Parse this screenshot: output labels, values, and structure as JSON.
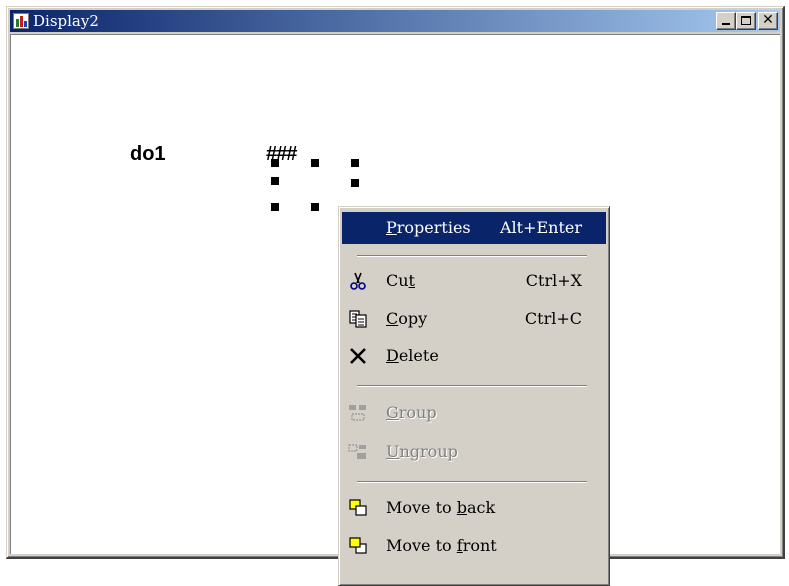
{
  "window": {
    "title": "Display2"
  },
  "canvas": {
    "label": "do1",
    "object_text": "###"
  },
  "context_menu": {
    "items": [
      {
        "pre": "",
        "key": "P",
        "post": "roperties",
        "shortcut": "Alt+Enter",
        "icon": null,
        "state": "selected"
      },
      {
        "pre": "Cu",
        "key": "t",
        "post": "",
        "shortcut": "Ctrl+X",
        "icon": "scissors-icon",
        "state": "enabled"
      },
      {
        "pre": "",
        "key": "C",
        "post": "opy",
        "shortcut": "Ctrl+C",
        "icon": "copy-icon",
        "state": "enabled"
      },
      {
        "pre": "",
        "key": "D",
        "post": "elete",
        "shortcut": "",
        "icon": "delete-x-icon",
        "state": "enabled"
      },
      {
        "pre": "",
        "key": "G",
        "post": "roup",
        "shortcut": "",
        "icon": "group-icon",
        "state": "disabled"
      },
      {
        "pre": "",
        "key": "U",
        "post": "ngroup",
        "shortcut": "",
        "icon": "ungroup-icon",
        "state": "disabled"
      },
      {
        "pre": "Move to ",
        "key": "b",
        "post": "ack",
        "shortcut": "",
        "icon": "move-to-back-icon",
        "state": "enabled"
      },
      {
        "pre": "Move to ",
        "key": "f",
        "post": "ront",
        "shortcut": "",
        "icon": "move-to-front-icon",
        "state": "enabled"
      }
    ]
  },
  "colors": {
    "title_active": "#0a246a",
    "face": "#d4d0c8",
    "menu_highlight": "#0a246a"
  }
}
